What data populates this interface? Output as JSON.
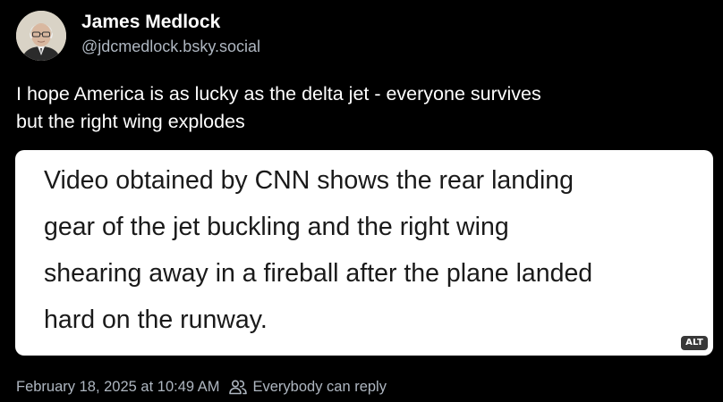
{
  "author": {
    "display_name": "James Medlock",
    "handle": "@jdcmedlock.bsky.social",
    "avatar_icon": "user-avatar"
  },
  "post": {
    "text_lines": [
      "I hope America is as lucky as the delta jet - everyone survives",
      "but the right wing explodes"
    ]
  },
  "media": {
    "text_lines": [
      "Video obtained by CNN shows the rear landing",
      "gear of the jet buckling and the right wing",
      "shearing away in a fireball after the plane landed",
      "hard on the runway."
    ],
    "alt_badge": "ALT"
  },
  "meta": {
    "timestamp": "February 18, 2025 at 10:49 AM",
    "reply_setting": "Everybody can reply",
    "reply_icon": "people-icon"
  },
  "colors": {
    "background": "#000000",
    "primary_text": "#ffffff",
    "secondary_text": "#aeb6c0",
    "card_background": "#ffffff",
    "card_text": "#1a1a1a"
  }
}
